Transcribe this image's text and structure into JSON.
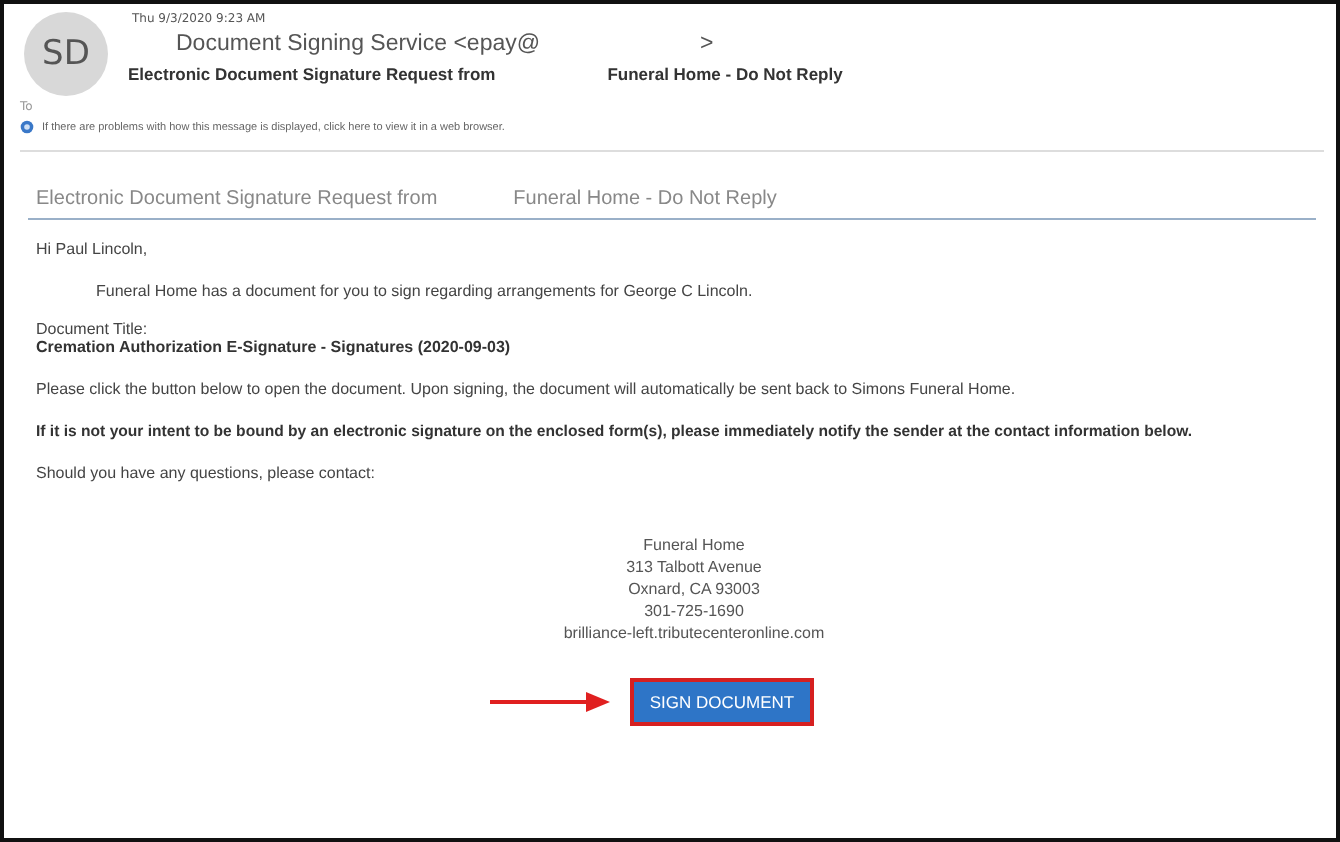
{
  "header": {
    "avatar": "SD",
    "date": "Thu 9/3/2020 9:23 AM",
    "sender": "Document Signing Service <epay@",
    "sender_end": ">",
    "subject_start": "Electronic Document Signature Request from",
    "subject_end": "Funeral Home  -  Do Not Reply",
    "to_label": "To",
    "info": "If there are problems with how this message is displayed, click here to view it in a web browser."
  },
  "body": {
    "title_start": "Electronic Document Signature Request from",
    "title_end": "Funeral Home - Do Not Reply",
    "greeting": "Hi Paul Lincoln,",
    "intro": "Funeral Home has a document for you to sign regarding arrangements for George C Lincoln.",
    "doc_label": "Document Title:",
    "doc_title": "Cremation Authorization E-Signature - Signatures (2020-09-03)",
    "instructions": "Please click the button below to open the document. Upon signing, the document will automatically be sent back to Simons Funeral Home.",
    "warning": "If it is not your intent to be bound by an electronic signature on the enclosed form(s), please immediately notify the sender at the contact information below.",
    "questions": "Should you have any questions, please contact:",
    "contact": [
      "Funeral Home",
      "313 Talbott Avenue",
      "Oxnard, CA 93003",
      "301-725-1690",
      "brilliance-left.tributecenteronline.com"
    ],
    "button": "SIGN DOCUMENT"
  }
}
